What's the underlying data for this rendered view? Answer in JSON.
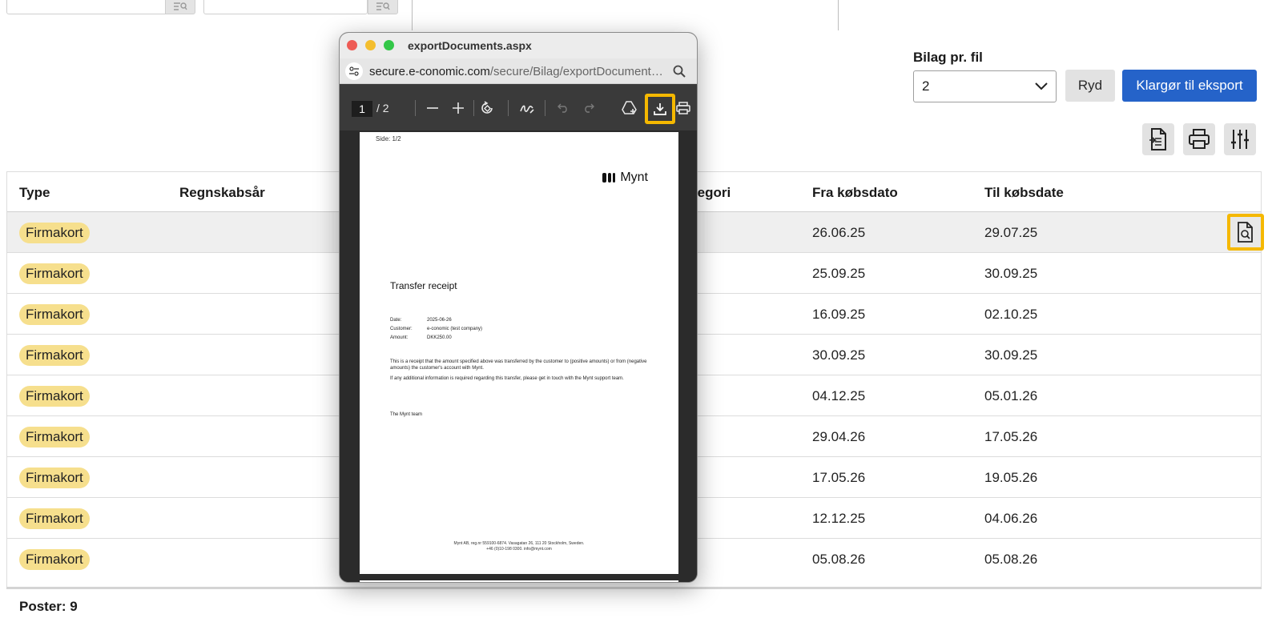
{
  "settings": {
    "bilag_label": "Bilag pr. fil",
    "bilag_value": "2",
    "clear_label": "Ryd",
    "export_label": "Klargør til eksport"
  },
  "table": {
    "headers": {
      "type": "Type",
      "year": "Regnskabsår",
      "category": "tegori",
      "from": "Fra købsdato",
      "to": "Til købsdate"
    },
    "rows": [
      {
        "type": "Firmakort",
        "from": "26.06.25",
        "to": "29.07.25"
      },
      {
        "type": "Firmakort",
        "from": "25.09.25",
        "to": "30.09.25"
      },
      {
        "type": "Firmakort",
        "from": "16.09.25",
        "to": "02.10.25"
      },
      {
        "type": "Firmakort",
        "from": "30.09.25",
        "to": "30.09.25"
      },
      {
        "type": "Firmakort",
        "from": "04.12.25",
        "to": "05.01.26"
      },
      {
        "type": "Firmakort",
        "from": "29.04.26",
        "to": "17.05.26"
      },
      {
        "type": "Firmakort",
        "from": "17.05.26",
        "to": "19.05.26"
      },
      {
        "type": "Firmakort",
        "from": "12.12.25",
        "to": "04.06.26"
      },
      {
        "type": "Firmakort",
        "from": "05.08.26",
        "to": "05.08.26"
      }
    ],
    "footer": "Poster: 9"
  },
  "popup": {
    "title": "exportDocuments.aspx",
    "url_host": "secure.e-conomic.com",
    "url_path": "/secure/Bilag/exportDocument…",
    "page_current": "1",
    "page_total": "/ 2",
    "pdf": {
      "side": "Side: 1/2",
      "logo": "Mynt",
      "heading": "Transfer receipt",
      "date_label": "Date:",
      "date_value": "2025-06-26",
      "customer_label": "Customer:",
      "customer_value": "e-conomic (test company)",
      "amount_label": "Amount:",
      "amount_value": "DKK250.00",
      "para1": "This is a receipt that the amount specified above was transferred by the customer to (positive amounts) or from (negative amounts) the customer's account with Mynt.",
      "para2": "If any additional information is required regarding this transfer, please get in touch with the Mynt support team.",
      "signoff": "The Mynt team",
      "footer_line1": "Mynt AB, reg.nr 559100-6874. Vasagatan 26, 111 20 Stockholm, Sweden.",
      "footer_line2": "+46 (0)10-198 0300. info@mynt.com"
    }
  }
}
